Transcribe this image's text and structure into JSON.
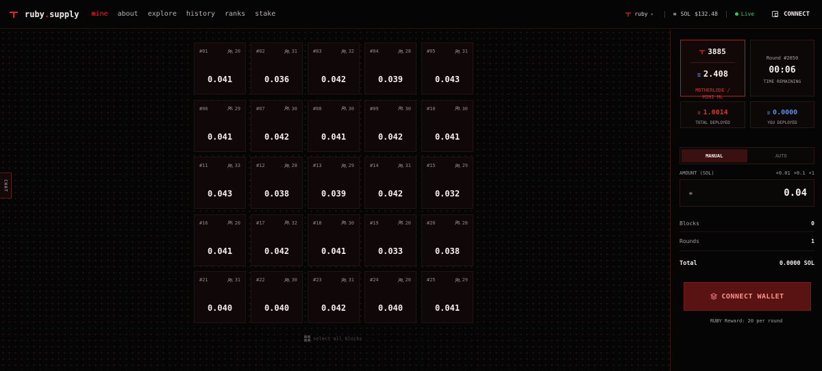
{
  "brand": {
    "name_main": "ruby",
    "name_dot": ".",
    "name_tail": "supply"
  },
  "nav": [
    {
      "label": "mine",
      "active": true
    },
    {
      "label": "about",
      "active": false
    },
    {
      "label": "explore",
      "active": false
    },
    {
      "label": "history",
      "active": false
    },
    {
      "label": "ranks",
      "active": false
    },
    {
      "label": "stake",
      "active": false
    }
  ],
  "header": {
    "token": "ruby",
    "sol_label": "SOL",
    "sol_price": "$132.48",
    "live_label": "Live",
    "connect_label": "CONNECT"
  },
  "chat_label": "CHAT",
  "blocks": [
    {
      "id": "#01",
      "miners": "20",
      "amount": "0.041"
    },
    {
      "id": "#02",
      "miners": "31",
      "amount": "0.036"
    },
    {
      "id": "#03",
      "miners": "32",
      "amount": "0.042"
    },
    {
      "id": "#04",
      "miners": "28",
      "amount": "0.039"
    },
    {
      "id": "#05",
      "miners": "31",
      "amount": "0.043"
    },
    {
      "id": "#06",
      "miners": "29",
      "amount": "0.041"
    },
    {
      "id": "#07",
      "miners": "30",
      "amount": "0.042"
    },
    {
      "id": "#08",
      "miners": "30",
      "amount": "0.041"
    },
    {
      "id": "#09",
      "miners": "30",
      "amount": "0.042"
    },
    {
      "id": "#10",
      "miners": "30",
      "amount": "0.041"
    },
    {
      "id": "#11",
      "miners": "33",
      "amount": "0.043"
    },
    {
      "id": "#12",
      "miners": "28",
      "amount": "0.038"
    },
    {
      "id": "#13",
      "miners": "29",
      "amount": "0.039"
    },
    {
      "id": "#14",
      "miners": "31",
      "amount": "0.042"
    },
    {
      "id": "#15",
      "miners": "29",
      "amount": "0.032"
    },
    {
      "id": "#16",
      "miners": "20",
      "amount": "0.041"
    },
    {
      "id": "#17",
      "miners": "32",
      "amount": "0.042"
    },
    {
      "id": "#18",
      "miners": "30",
      "amount": "0.041"
    },
    {
      "id": "#19",
      "miners": "20",
      "amount": "0.033"
    },
    {
      "id": "#20",
      "miners": "28",
      "amount": "0.038"
    },
    {
      "id": "#21",
      "miners": "31",
      "amount": "0.040"
    },
    {
      "id": "#22",
      "miners": "30",
      "amount": "0.040"
    },
    {
      "id": "#23",
      "miners": "31",
      "amount": "0.042"
    },
    {
      "id": "#24",
      "miners": "20",
      "amount": "0.040"
    },
    {
      "id": "#25",
      "miners": "29",
      "amount": "0.041"
    }
  ],
  "select_all_label": "select all blocks",
  "panel": {
    "motherlode_ruby": "3885",
    "motherlode_sol": "2.408",
    "motherlode_label_1": "MOTHERLODE /",
    "motherlode_label_2": "MINI ML",
    "round_label": "Round #2050",
    "time_remaining": "00:06",
    "time_label": "TIME REMAINING",
    "total_deployed": "1.0014",
    "total_deployed_label": "TOTAL DEPLOYED",
    "you_deployed": "0.0000",
    "you_deployed_label": "YOU DEPLOYED",
    "mode_manual": "MANUAL",
    "mode_auto": "AUTO",
    "amount_label": "AMOUNT (SOL)",
    "quick_1": "+0.01",
    "quick_2": "+0.1",
    "quick_3": "+1",
    "sol_symbol": "≡",
    "amount_value": "0.04",
    "blocks_label": "Blocks",
    "blocks_value": "0",
    "rounds_label": "Rounds",
    "rounds_value": "1",
    "total_label": "Total",
    "total_value": "0.0000 SOL",
    "wallet_label": "CONNECT WALLET",
    "reward_text": "RUBY Reward: 20 per round"
  },
  "colors": {
    "accent": "#e02727",
    "sol_blue": "#5b8de0",
    "live_green": "#2ecc55"
  }
}
